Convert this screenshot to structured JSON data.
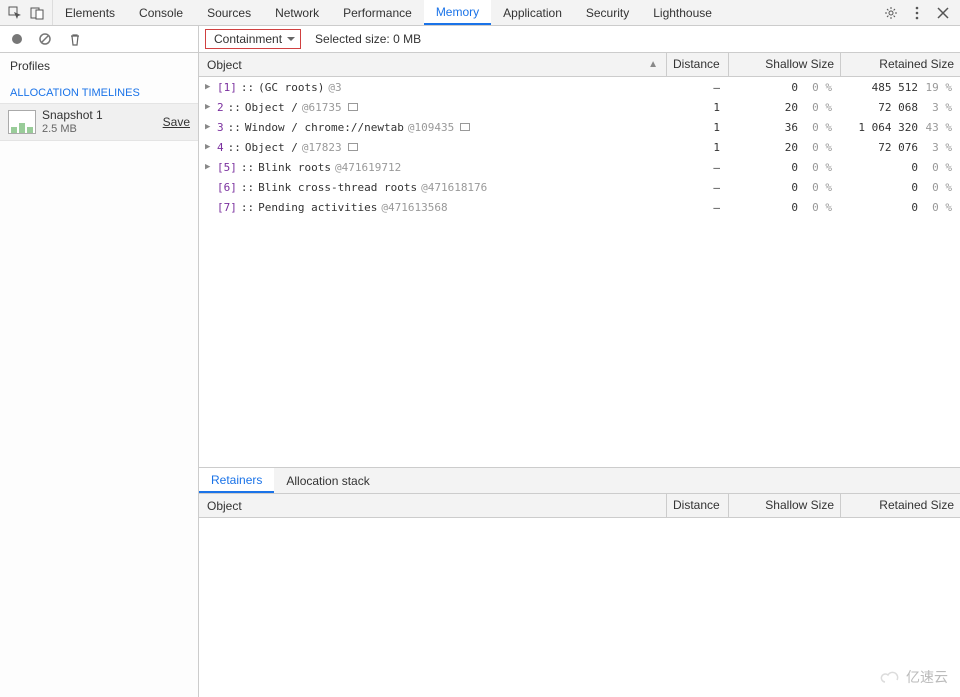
{
  "tabs": {
    "items": [
      "Elements",
      "Console",
      "Sources",
      "Network",
      "Performance",
      "Memory",
      "Application",
      "Security",
      "Lighthouse"
    ],
    "active": "Memory"
  },
  "toolbar": {
    "dropdown_label": "Containment",
    "selected_size_label": "Selected size: 0 MB"
  },
  "sidebar": {
    "profiles_label": "Profiles",
    "section_heading": "ALLOCATION TIMELINES",
    "snapshot": {
      "name": "Snapshot 1",
      "size": "2.5 MB",
      "save": "Save"
    }
  },
  "columns": {
    "object": "Object",
    "distance": "Distance",
    "shallow": "Shallow Size",
    "retained": "Retained Size"
  },
  "rows": [
    {
      "twisty": true,
      "idx": "[1]",
      "sep": "::",
      "rest": "(GC roots)",
      "addr": "@3",
      "win": false,
      "dist": "–",
      "sh": "0",
      "shp": "0 %",
      "rt": "485 512",
      "rtp": "19 %"
    },
    {
      "twisty": true,
      "idx": "2",
      "sep": "::",
      "rest": "Object /",
      "addr": "@61735",
      "win": true,
      "dist": "1",
      "sh": "20",
      "shp": "0 %",
      "rt": "72 068",
      "rtp": "3 %"
    },
    {
      "twisty": true,
      "idx": "3",
      "sep": "::",
      "rest": "Window / chrome://newtab",
      "addr": "@109435",
      "win": true,
      "dist": "1",
      "sh": "36",
      "shp": "0 %",
      "rt": "1 064 320",
      "rtp": "43 %"
    },
    {
      "twisty": true,
      "idx": "4",
      "sep": "::",
      "rest": "Object /",
      "addr": "@17823",
      "win": true,
      "dist": "1",
      "sh": "20",
      "shp": "0 %",
      "rt": "72 076",
      "rtp": "3 %"
    },
    {
      "twisty": true,
      "idx": "[5]",
      "sep": "::",
      "rest": "Blink roots",
      "addr": "@471619712",
      "win": false,
      "dist": "–",
      "sh": "0",
      "shp": "0 %",
      "rt": "0",
      "rtp": "0 %"
    },
    {
      "twisty": false,
      "idx": "[6]",
      "sep": "::",
      "rest": "Blink cross-thread roots",
      "addr": "@471618176",
      "win": false,
      "dist": "–",
      "sh": "0",
      "shp": "0 %",
      "rt": "0",
      "rtp": "0 %"
    },
    {
      "twisty": false,
      "idx": "[7]",
      "sep": "::",
      "rest": "Pending activities",
      "addr": "@471613568",
      "win": false,
      "dist": "–",
      "sh": "0",
      "shp": "0 %",
      "rt": "0",
      "rtp": "0 %"
    }
  ],
  "retainers": {
    "tabs": [
      "Retainers",
      "Allocation stack"
    ],
    "active": "Retainers",
    "columns": {
      "object": "Object",
      "distance": "Distance",
      "shallow": "Shallow Size",
      "retained": "Retained Size"
    }
  },
  "watermark": "亿速云"
}
